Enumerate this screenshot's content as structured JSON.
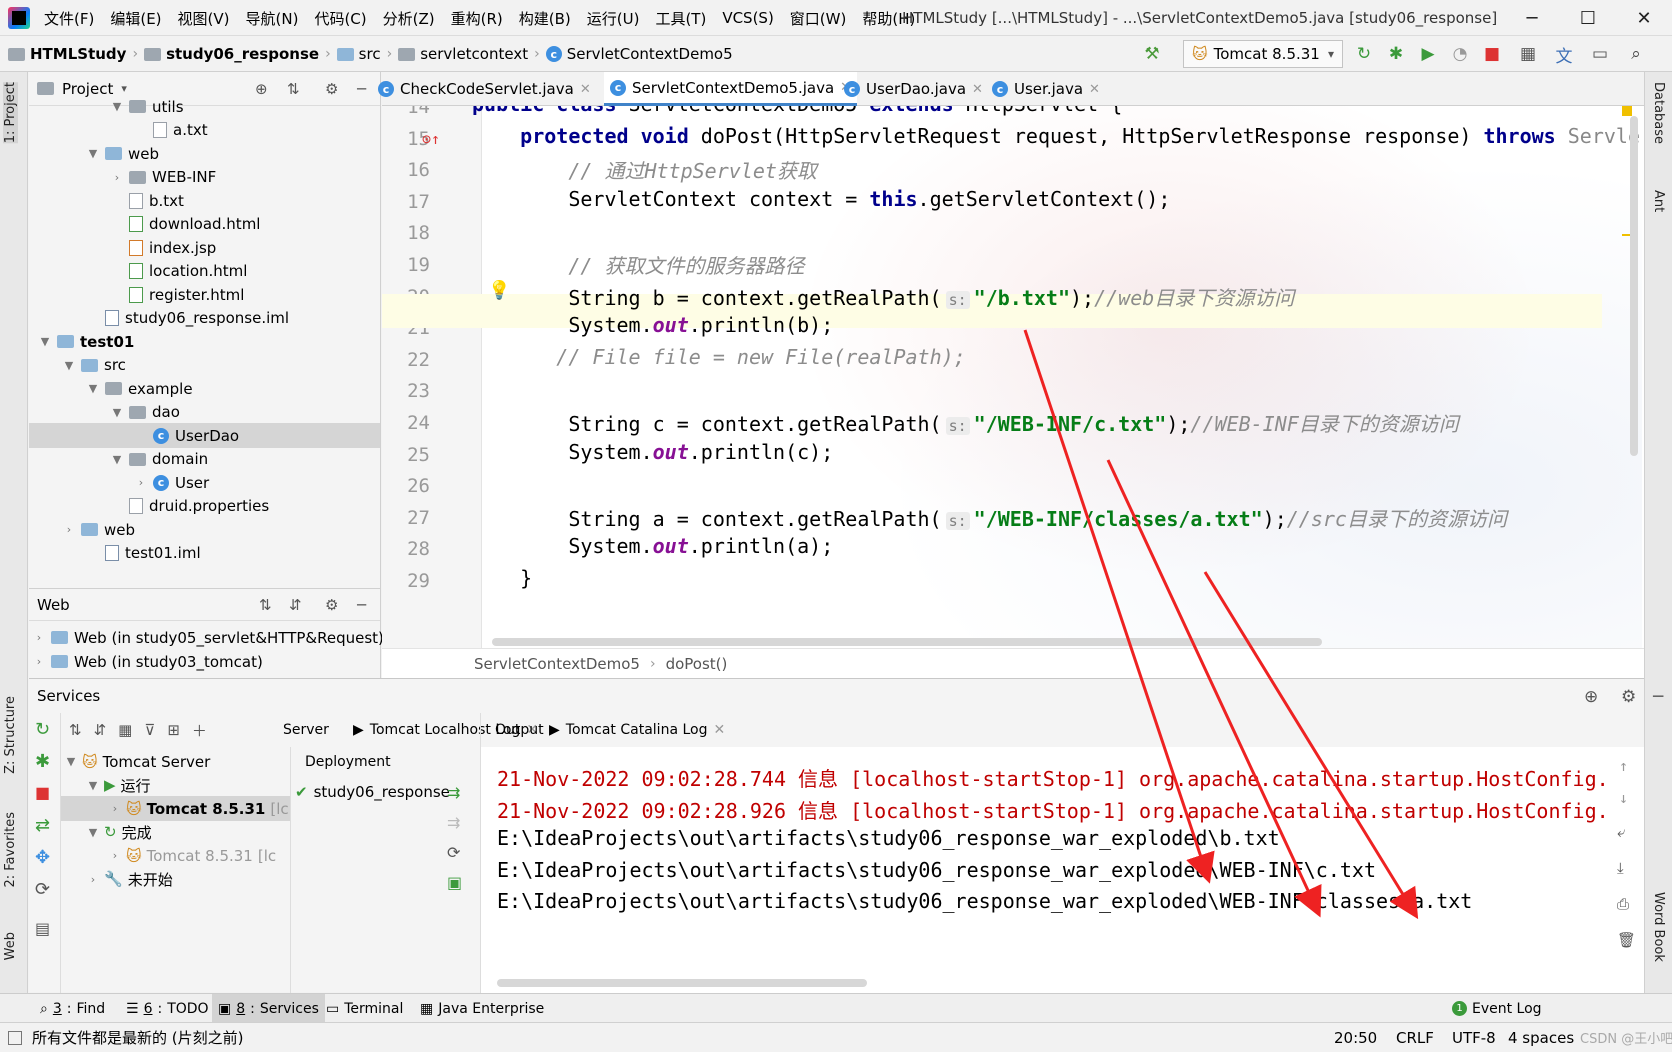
{
  "app": {
    "menu": [
      "文件(F)",
      "编辑(E)",
      "视图(V)",
      "导航(N)",
      "代码(C)",
      "分析(Z)",
      "重构(R)",
      "构建(B)",
      "运行(U)",
      "工具(T)",
      "VCS(S)",
      "窗口(W)",
      "帮助(H)"
    ],
    "window_title": "HTMLStudy [...\\HTMLStudy] - ...\\ServletContextDemo5.java [study06_response]"
  },
  "nav": {
    "crumbs": [
      "HTMLStudy",
      "study06_response",
      "src",
      "servletcontext",
      "ServletContextDemo5"
    ],
    "run_config": "Tomcat 8.5.31"
  },
  "left_stripe": {
    "project": "1: Project",
    "structure": "Z: Structure",
    "favorites": "2: Favorites",
    "web": "Web"
  },
  "right_stripe": {
    "database": "Database",
    "ant": "Ant",
    "wordbook": "Word Book"
  },
  "project": {
    "title": "Project",
    "items": [
      {
        "label": "utils",
        "indent": 4,
        "type": "folder",
        "arrow": "▼"
      },
      {
        "label": "a.txt",
        "indent": 5,
        "type": "txt",
        "arrow": ""
      },
      {
        "label": "web",
        "indent": 3,
        "type": "folder",
        "arrow": "▼"
      },
      {
        "label": "WEB-INF",
        "indent": 4,
        "type": "folder",
        "arrow": "›"
      },
      {
        "label": "b.txt",
        "indent": 4,
        "type": "txt",
        "arrow": ""
      },
      {
        "label": "download.html",
        "indent": 4,
        "type": "html",
        "arrow": ""
      },
      {
        "label": "index.jsp",
        "indent": 4,
        "type": "jsp",
        "arrow": ""
      },
      {
        "label": "location.html",
        "indent": 4,
        "type": "html",
        "arrow": ""
      },
      {
        "label": "register.html",
        "indent": 4,
        "type": "html",
        "arrow": ""
      },
      {
        "label": "study06_response.iml",
        "indent": 3,
        "type": "iml",
        "arrow": ""
      },
      {
        "label": "test01",
        "indent": 1,
        "type": "module",
        "arrow": "▼",
        "bold": true
      },
      {
        "label": "src",
        "indent": 2,
        "type": "folder",
        "arrow": "▼"
      },
      {
        "label": "example",
        "indent": 3,
        "type": "folder",
        "arrow": "▼"
      },
      {
        "label": "dao",
        "indent": 4,
        "type": "folder",
        "arrow": "▼"
      },
      {
        "label": "UserDao",
        "indent": 5,
        "type": "class",
        "arrow": "",
        "selected": true
      },
      {
        "label": "domain",
        "indent": 4,
        "type": "folder",
        "arrow": "▼"
      },
      {
        "label": "User",
        "indent": 5,
        "type": "class",
        "arrow": "›"
      },
      {
        "label": "druid.properties",
        "indent": 4,
        "type": "txt",
        "arrow": ""
      },
      {
        "label": "web",
        "indent": 2,
        "type": "folder",
        "arrow": "›"
      },
      {
        "label": "test01.iml",
        "indent": 3,
        "type": "iml",
        "arrow": ""
      }
    ]
  },
  "web_panel": {
    "title": "Web",
    "items": [
      "Web (in study05_servlet&HTTP&Request)",
      "Web (in study03_tomcat)"
    ]
  },
  "tabs": [
    {
      "label": "CheckCodeServlet.java",
      "active": false
    },
    {
      "label": "ServletContextDemo5.java",
      "active": true
    },
    {
      "label": "UserDao.java",
      "active": false
    },
    {
      "label": "User.java",
      "active": false
    }
  ],
  "code": {
    "lines": [
      {
        "n": "14",
        "html": "<span class='kw'>public class</span> ServletContextDemo5 <span class='kw'>extends</span> HttpServlet {"
      },
      {
        "n": "15",
        "html": "    <span class='kw'>protected void</span> doPost(HttpServletRequest request, HttpServletResponse response) <span class='kw'>throws</span> <span style='color:#888'>Servle</span>"
      },
      {
        "n": "16",
        "html": "        <span class='cm'>// 通过HttpServlet获取</span>"
      },
      {
        "n": "17",
        "html": "        ServletContext context = <span class='kw'>this</span>.getServletContext();"
      },
      {
        "n": "18",
        "html": ""
      },
      {
        "n": "19",
        "html": "        <span class='cm'>// 获取文件的服务器路径</span>"
      },
      {
        "n": "20",
        "html": "        String b = context.getRealPath(<span class='hint'>s:</span><span class='str'>\"/b.txt\"</span>);<span class='cm'>//web目录下资源访问</span>"
      },
      {
        "n": "21",
        "html": "        System.<span class='fld'>out</span>.println(b);"
      },
      {
        "n": "22",
        "html": "       <span class='cm'>// File file = new File(realPath);</span>"
      },
      {
        "n": "23",
        "html": ""
      },
      {
        "n": "24",
        "html": "        String c = context.getRealPath(<span class='hint'>s:</span><span class='str'>\"/WEB-INF/c.txt\"</span>);<span class='cm'>//WEB-INF目录下的资源访问</span>"
      },
      {
        "n": "25",
        "html": "        System.<span class='fld'>out</span>.println(c);"
      },
      {
        "n": "26",
        "html": ""
      },
      {
        "n": "27",
        "html": "        String a = context.getRealPath(<span class='hint'>s:</span><span class='str'>\"/WEB-INF/classes/a.txt\"</span>);<span class='cm'>//src目录下的资源访问</span>"
      },
      {
        "n": "28",
        "html": "        System.<span class='fld'>out</span>.println(a);"
      },
      {
        "n": "29",
        "html": "    }"
      }
    ]
  },
  "editor_breadcrumb": {
    "cls": "ServletContextDemo5",
    "method": "doPost()"
  },
  "services": {
    "title": "Services",
    "tree": [
      {
        "label": "Tomcat Server",
        "indent": 0,
        "arrow": "▼"
      },
      {
        "label": "运行",
        "indent": 1,
        "arrow": "▼"
      },
      {
        "label": "Tomcat 8.5.31",
        "suffix": " [lc",
        "indent": 2,
        "arrow": "›",
        "bold": true,
        "selected": true
      },
      {
        "label": "完成",
        "indent": 1,
        "arrow": "▼"
      },
      {
        "label": "Tomcat 8.5.31",
        "suffix": " [lc",
        "indent": 2,
        "arrow": "›",
        "muted": true
      },
      {
        "label": "未开始",
        "indent": 1,
        "arrow": "›"
      }
    ],
    "subtabs": [
      "Server",
      "Tomcat Localhost Log",
      "Tomcat Catalina Log"
    ],
    "deployment_label": "Deployment",
    "deployment_item": "study06_response",
    "output_label": "Output",
    "output": [
      {
        "text": "21-Nov-2022 09:02:28.744 信息 [localhost-startStop-1] org.apache.catalina.startup.HostConfig.",
        "red": true
      },
      {
        "text": "21-Nov-2022 09:02:28.926 信息 [localhost-startStop-1] org.apache.catalina.startup.HostConfig.",
        "red": true
      },
      {
        "text": "E:\\IdeaProjects\\out\\artifacts\\study06_response_war_exploded\\b.txt",
        "red": false
      },
      {
        "text": "E:\\IdeaProjects\\out\\artifacts\\study06_response_war_exploded\\WEB-INF\\c.txt",
        "red": false
      },
      {
        "text": "E:\\IdeaProjects\\out\\artifacts\\study06_response_war_exploded\\WEB-INF\\classes\\a.txt",
        "red": false
      }
    ]
  },
  "bottom_tools": [
    {
      "num": "3",
      "label": "Find"
    },
    {
      "num": "6",
      "label": "TODO"
    },
    {
      "num": "8",
      "label": "Services",
      "active": true
    },
    {
      "num": "",
      "label": "Terminal"
    },
    {
      "num": "",
      "label": "Java Enterprise"
    }
  ],
  "event_log": {
    "count": "1",
    "label": "Event Log"
  },
  "status": {
    "message": "所有文件都是最新的 (片刻之前)",
    "position": "20:50",
    "line_sep": "CRLF",
    "encoding": "UTF-8",
    "indent": "4 spaces",
    "watermark": "CSDN @王小吧"
  }
}
